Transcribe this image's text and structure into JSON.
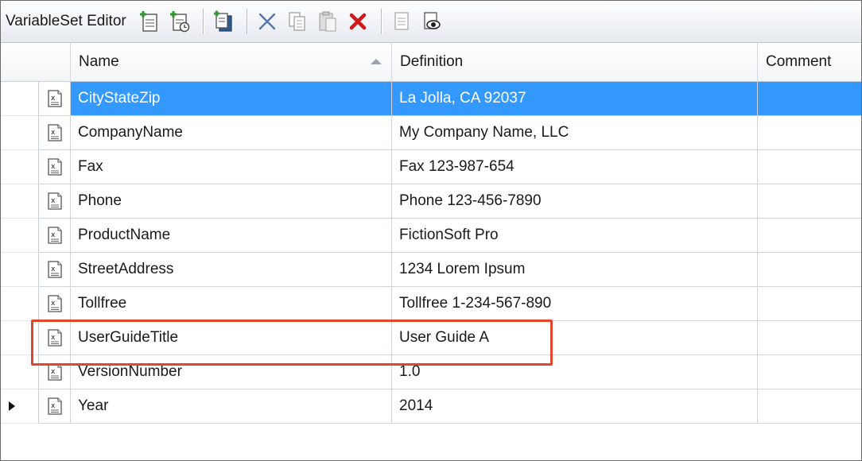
{
  "toolbar": {
    "title": "VariableSet Editor",
    "buttons": [
      {
        "icon": "add-variable-icon"
      },
      {
        "icon": "add-datetime-variable-icon"
      },
      {
        "icon": "import-variable-icon"
      },
      {
        "icon": "cut-icon"
      },
      {
        "icon": "copy-icon"
      },
      {
        "icon": "paste-icon"
      },
      {
        "icon": "delete-icon"
      },
      {
        "icon": "variable-properties-icon"
      },
      {
        "icon": "preview-icon"
      }
    ]
  },
  "grid": {
    "columns": [
      {
        "label": "Name",
        "sorted": "ascending"
      },
      {
        "label": "Definition"
      },
      {
        "label": "Comment"
      }
    ],
    "rows": [
      {
        "name": "CityStateZip",
        "definition": "La Jolla, CA 92037",
        "comment": "",
        "selected": true
      },
      {
        "name": "CompanyName",
        "definition": "My Company Name, LLC",
        "comment": ""
      },
      {
        "name": "Fax",
        "definition": "Fax 123-987-654",
        "comment": ""
      },
      {
        "name": "Phone",
        "definition": "Phone 123-456-7890",
        "comment": ""
      },
      {
        "name": "ProductName",
        "definition": "FictionSoft Pro",
        "comment": ""
      },
      {
        "name": "StreetAddress",
        "definition": "1234 Lorem Ipsum",
        "comment": ""
      },
      {
        "name": "Tollfree",
        "definition": "Tollfree 1-234-567-890",
        "comment": ""
      },
      {
        "name": "UserGuideTitle",
        "definition": "User Guide A",
        "comment": "",
        "highlighted": true
      },
      {
        "name": "VersionNumber",
        "definition": "1.0",
        "comment": ""
      },
      {
        "name": "Year",
        "definition": "2014",
        "comment": "",
        "current": true
      }
    ]
  },
  "colors": {
    "selection": "#3399ff",
    "highlight_border": "#e2462a",
    "delete_red": "#d0181b"
  }
}
